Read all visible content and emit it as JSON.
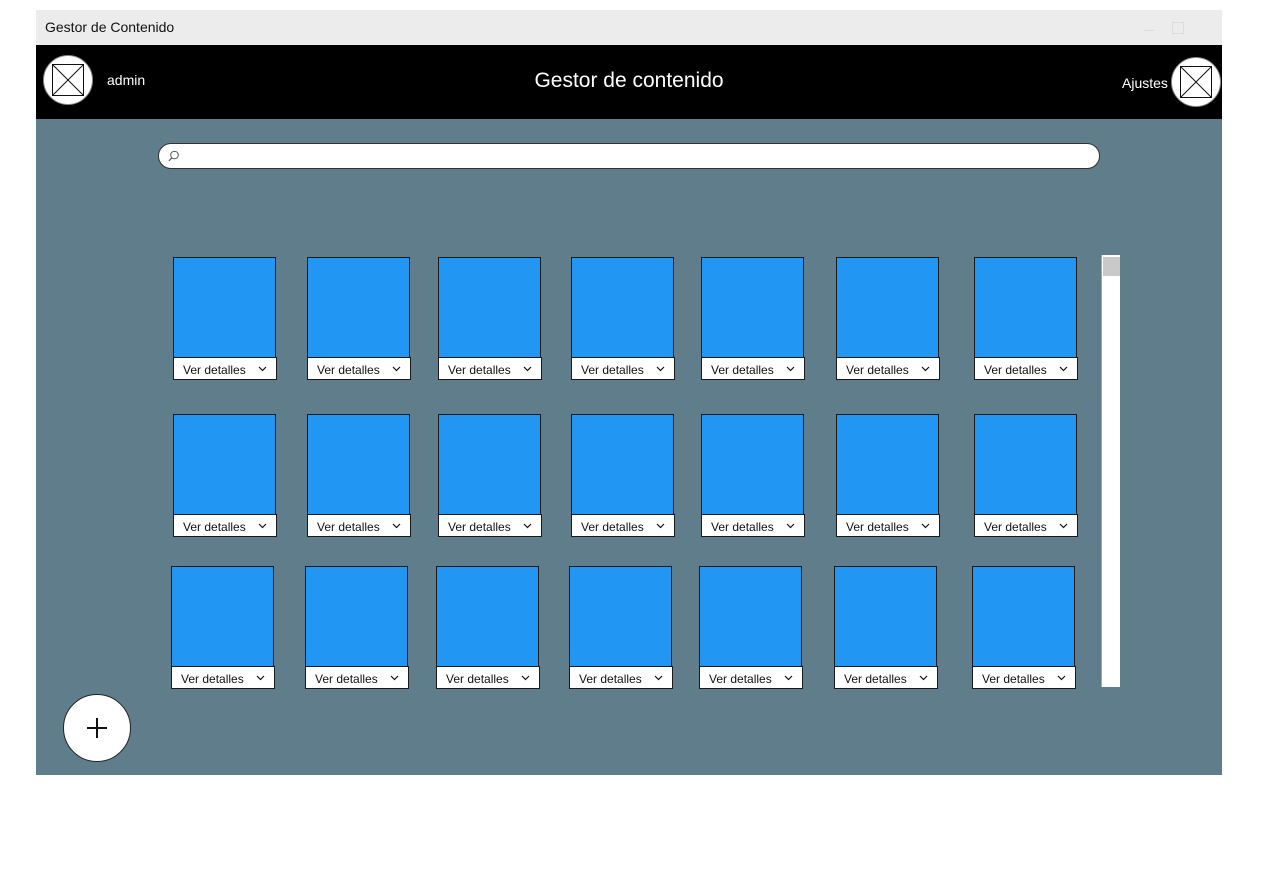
{
  "window": {
    "title": "Gestor de Contenido"
  },
  "header": {
    "username": "admin",
    "title": "Gestor de contenido",
    "settings_label": "Ajustes"
  },
  "search": {
    "placeholder": "",
    "value": ""
  },
  "grid": {
    "rows": 3,
    "columns": 7,
    "thumbnail_color": "#2196f3",
    "details_label": "Ver detalles"
  },
  "colors": {
    "header_bg": "#000000",
    "content_bg": "#607d8b",
    "titlebar_bg": "#ececec"
  },
  "add_button": {
    "icon": "plus-icon"
  }
}
